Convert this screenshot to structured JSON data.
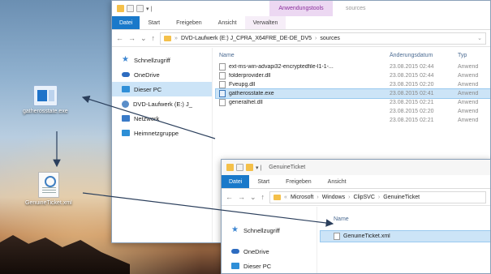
{
  "desktop": {
    "icon_exe_label": "gatherosstate.exe",
    "icon_xml_label": "GenuineTicket.xml"
  },
  "window1": {
    "ctx_tab": "Anwendungstools",
    "title": "sources",
    "tabs": [
      "Datei",
      "Start",
      "Freigeben",
      "Ansicht",
      "Verwalten"
    ],
    "address": [
      "DVD-Laufwerk (E:) J_CPRA_X64FRE_DE-DE_DV5",
      "sources"
    ],
    "nav": [
      {
        "label": "Schnellzugriff",
        "icon": "star-icon"
      },
      {
        "label": "OneDrive",
        "icon": "cloud-icon"
      },
      {
        "label": "Dieser PC",
        "icon": "pc-icon"
      },
      {
        "label": "DVD-Laufwerk (E:) J_",
        "icon": "dvd-icon"
      },
      {
        "label": "Netzwerk",
        "icon": "network-icon"
      },
      {
        "label": "Heimnetzgruppe",
        "icon": "homegroup-icon"
      }
    ],
    "columns": {
      "name": "Name",
      "date": "Änderungsdatum",
      "type": "Typ"
    },
    "files": [
      {
        "name": "ext-ms-win-advapi32-encryptedfile-l1-1-...",
        "date": "23.08.2015 02:44",
        "type": "Anwend"
      },
      {
        "name": "folderprovider.dll",
        "date": "23.08.2015 02:44",
        "type": "Anwend"
      },
      {
        "name": "Fveupg.dll",
        "date": "23.08.2015 02:20",
        "type": "Anwend"
      },
      {
        "name": "gatherosstate.exe",
        "date": "23.08.2015 02:41",
        "type": "Anwend"
      },
      {
        "name": "generalhel.dll",
        "date": "23.08.2015 02:21",
        "type": "Anwend"
      },
      {
        "name": "",
        "date": "23.08.2015 02:20",
        "type": "Anwend"
      },
      {
        "name": "",
        "date": "23.08.2015 02:21",
        "type": "Anwend"
      }
    ]
  },
  "window2": {
    "title": "GenuineTicket",
    "tabs": [
      "Datei",
      "Start",
      "Freigeben",
      "Ansicht"
    ],
    "address": [
      "Microsoft",
      "Windows",
      "ClipSVC",
      "GenuineTicket"
    ],
    "nav": [
      {
        "label": "Schnellzugriff",
        "icon": "star-icon"
      },
      {
        "label": "OneDrive",
        "icon": "cloud-icon"
      },
      {
        "label": "Dieser PC",
        "icon": "pc-icon"
      }
    ],
    "columns": {
      "name": "Name"
    },
    "files": [
      {
        "name": "GenuineTicket.xml"
      }
    ]
  },
  "colors": {
    "file_tab": "#1979ca",
    "selection": "#cce4f7",
    "context_tab": "#ecd8f2",
    "arrow": "#2b3f5c"
  }
}
